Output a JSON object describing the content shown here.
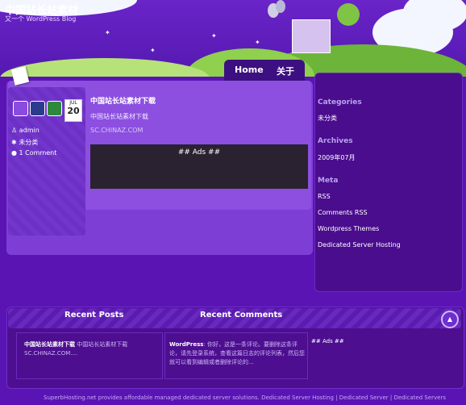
{
  "header": {
    "site_title": "中国站长站素材",
    "tagline": "又一个 WordPress Blog"
  },
  "nav": {
    "items": [
      {
        "label": "Home"
      },
      {
        "label": "关于"
      }
    ]
  },
  "search": {
    "placeholder": ""
  },
  "post": {
    "meta_author": "admin",
    "meta_category": "未分类",
    "meta_comments": "1 Comment",
    "calendar_month": "JUL",
    "calendar_day": "20",
    "title": "中国站长站素材下载",
    "excerpt": "中国站长站素材下载",
    "link": "SC.CHINAZ.COM",
    "ads": "## Ads ##"
  },
  "sidebar": {
    "categories_title": "Categories",
    "categories": [
      "未分类"
    ],
    "archives_title": "Archives",
    "archives": [
      "2009年07月"
    ],
    "meta_title": "Meta",
    "meta_items": [
      "RSS",
      "Comments RSS",
      "Wordpress Themes",
      "Dedicated Server Hosting"
    ]
  },
  "footer": {
    "recent_posts_title": "Recent Posts",
    "recent_comments_title": "Recent Comments",
    "recent_post_title": "中国站长站素材下载",
    "recent_post_excerpt": "中国站长站素材下载",
    "recent_post_link": "SC.CHINAZ.COM....",
    "comment_author": "WordPress",
    "comment_text": ": 你好，这是一条评论。要删除这条评论，请先登录系统，查看这篇日志的评论列表，然后您就可以看到编辑或者删除评论的...",
    "ads": "## Ads ##",
    "credit": "SuperbHosting.net provides affordable managed dedicated server solutions. Dedicated Server Hosting | Dedicated Server | Dedicated Servers"
  },
  "colors": {
    "background": "#5a14b4",
    "sidebar": "#4a0d8e",
    "ads_box": "#2a2230"
  }
}
